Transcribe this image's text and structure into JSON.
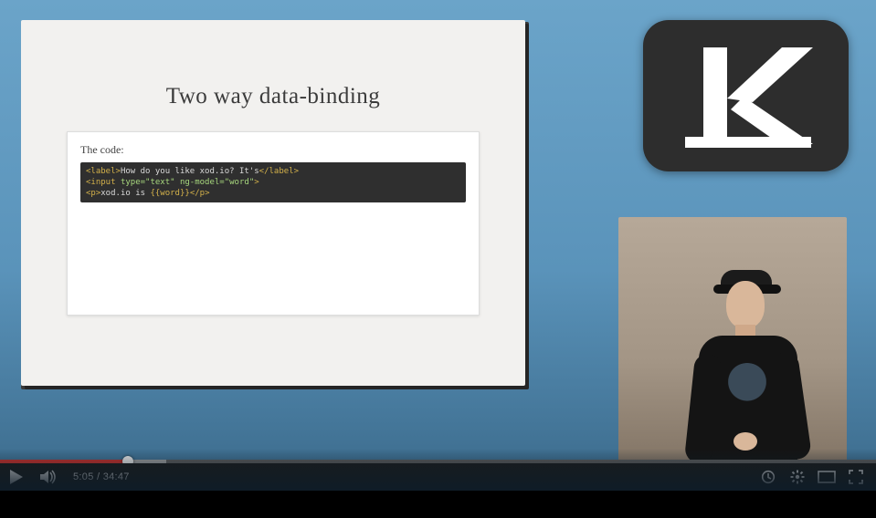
{
  "slide": {
    "title": "Two way data-binding",
    "panel_label": "The code:",
    "code_line1_tag_open": "<label>",
    "code_line1_text": "How do you like xod.io? It's",
    "code_line1_tag_close": "</label>",
    "code_line2_tag_open": "<input ",
    "code_line2_attrs": "type=\"text\" ng-model=\"word\"",
    "code_line2_tag_close": ">",
    "code_line3_tag_open": "<p>",
    "code_line3_text": "xod.io is ",
    "code_line3_bind": "{{word}}",
    "code_line3_tag_close": "</p>"
  },
  "logo": {
    "letter": "k"
  },
  "player": {
    "current_time": "5:05",
    "separator": " / ",
    "duration": "34:47",
    "played_percent": 14.6,
    "loaded_percent": 19
  },
  "icons": {
    "play": "play-icon",
    "volume": "volume-icon",
    "watch_later": "watch-later-icon",
    "settings": "settings-icon",
    "theater": "theater-icon",
    "fullscreen": "fullscreen-icon"
  }
}
